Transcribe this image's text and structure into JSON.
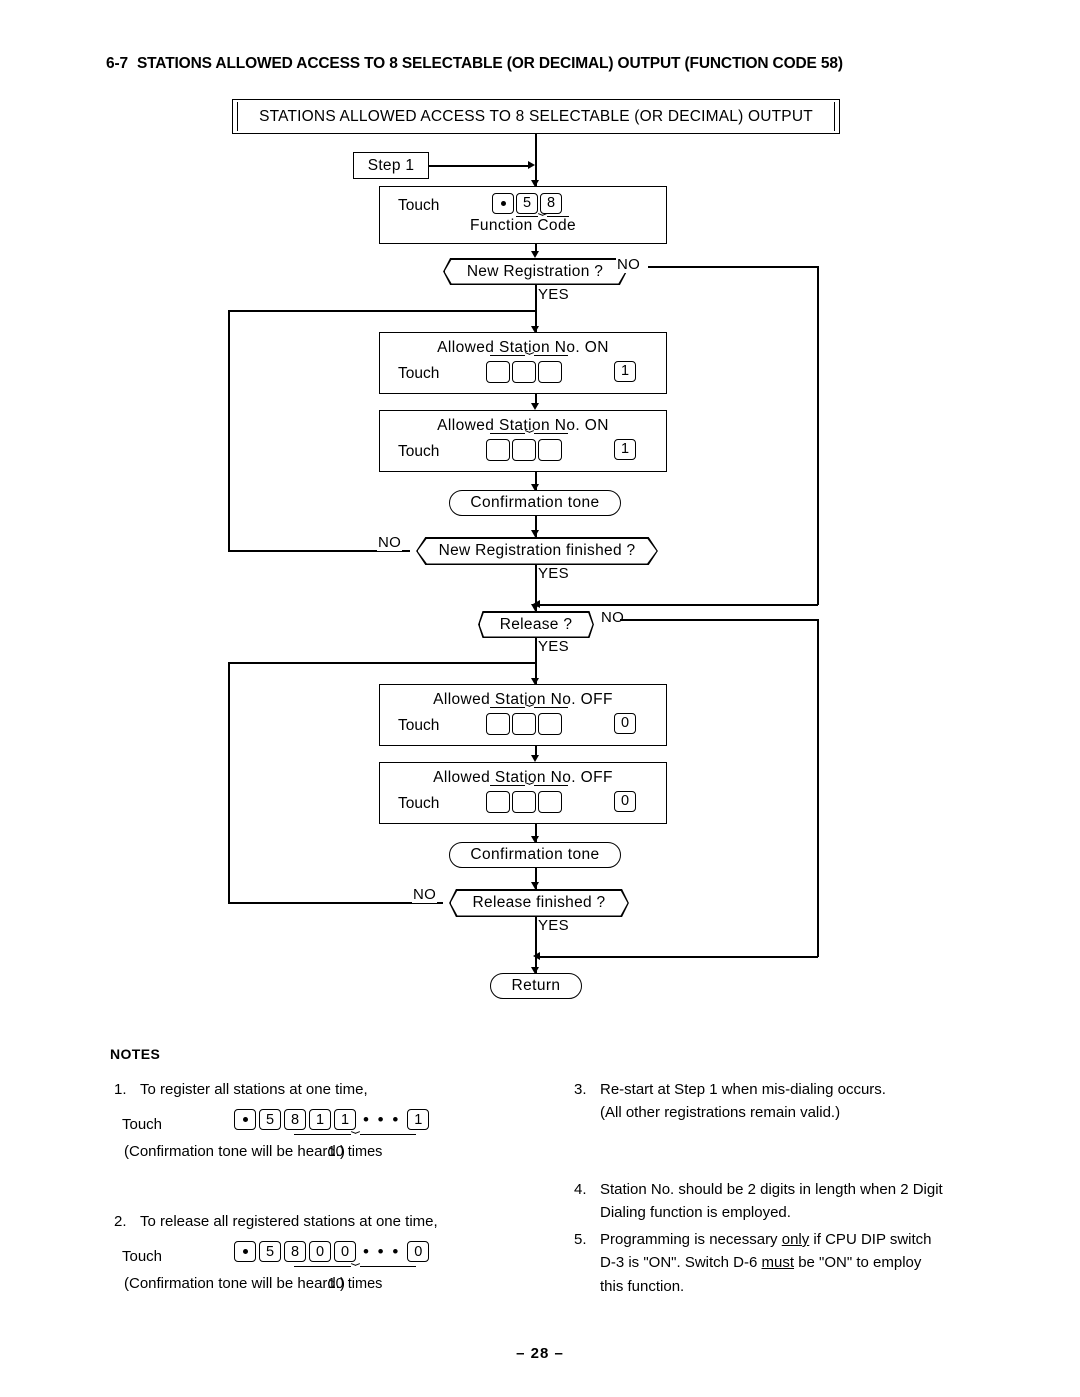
{
  "section": {
    "number": "6-7",
    "title": "STATIONS ALLOWED ACCESS TO 8 SELECTABLE (OR DECIMAL) OUTPUT (FUNCTION CODE 58)"
  },
  "flowchart": {
    "title_bar": "STATIONS ALLOWED ACCESS TO 8 SELECTABLE (OR DECIMAL) OUTPUT",
    "step_box": "Step  1",
    "function_box": {
      "touch_label": "Touch",
      "keys": [
        "•",
        "5",
        "8"
      ],
      "caption": "Function  Code"
    },
    "station_on_1": {
      "heading": "Allowed  Station  No.   ON",
      "touch_label": "Touch",
      "blank_keys": 3,
      "state_key": "1"
    },
    "station_on_2": {
      "heading": "Allowed  Station  No.   ON",
      "touch_label": "Touch",
      "blank_keys": 3,
      "state_key": "1"
    },
    "station_off_1": {
      "heading": "Allowed  Station  No.  OFF",
      "touch_label": "Touch",
      "blank_keys": 3,
      "state_key": "0"
    },
    "station_off_2": {
      "heading": "Allowed  Station  No.  OFF",
      "touch_label": "Touch",
      "blank_keys": 3,
      "state_key": "0"
    },
    "confirmation_tone_1": "Confirmation  tone",
    "confirmation_tone_2": "Confirmation  tone",
    "decisions": {
      "new_registration": "New Registration ?",
      "new_registration_finished": "New  Registration  finished  ?",
      "release": "Release  ?",
      "release_finished": "Release  finished  ?"
    },
    "edge_labels": {
      "newreg_no": "NO",
      "newreg_yes": "YES",
      "regfin_no": "NO",
      "regfin_yes": "YES",
      "release_no": "NO",
      "release_yes": "YES",
      "relfin_no": "NO",
      "relfin_yes": "YES"
    },
    "return_node": "Return"
  },
  "notes": {
    "heading": "NOTES",
    "items": [
      {
        "index": "1.",
        "text": "To register all stations at one time,",
        "touch_label": "Touch",
        "keys": [
          "•",
          "5",
          "8",
          "1",
          "1"
        ],
        "ellipsis": "• • •",
        "last_key": "1",
        "repeat_label": "10 times",
        "tail": "(Confirmation tone will be heard.)"
      },
      {
        "index": "2.",
        "text": "To release all registered stations at one time,",
        "touch_label": "Touch",
        "keys": [
          "•",
          "5",
          "8",
          "0",
          "0"
        ],
        "ellipsis": "• • •",
        "last_key": "0",
        "repeat_label": "10 times",
        "tail": "(Confirmation tone will be heard.)"
      },
      {
        "index": "3.",
        "line1": "Re-start at Step 1 when mis-dialing occurs.",
        "line2": "(All other registrations remain valid.)"
      },
      {
        "index": "4.",
        "line1": "Station  No.  should  be  2  digits  in  length  when  2 Digit",
        "line2": "Dialing function is employed."
      },
      {
        "index": "5.",
        "part1": "Programming  is  necessary  ",
        "em1": "only",
        "part2": "  if CPU  DIP  switch",
        "part3": "D-3 is \"ON\".  Switch D-6  ",
        "em2": "must",
        "part4": "  be \"ON\" to employ",
        "part5": "this function."
      }
    ]
  },
  "footer": {
    "page_number": "–  28  –"
  }
}
